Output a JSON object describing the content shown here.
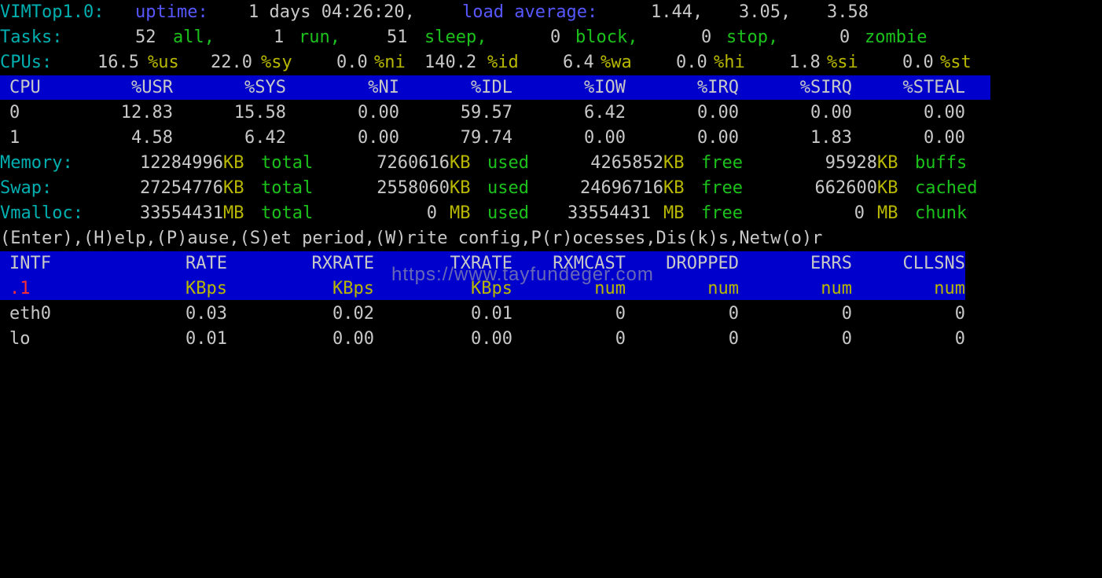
{
  "colors": {
    "background": "#000000",
    "header_bar": "#0000cc",
    "label_blue": "#5757ff",
    "label_cyan": "#00b0b0",
    "label_green": "#1cc21c",
    "unit_yellow": "#b8b800",
    "value_white": "#c8c8c8",
    "accent_red": "#ff3030"
  },
  "header": {
    "app": "VIMTop1.0:",
    "uptime_label": "uptime:",
    "uptime_value": "1 days 04:26:20,",
    "load_label": "load average:",
    "load_1": "1.44,",
    "load_5": "3.05,",
    "load_15": "3.58"
  },
  "tasks": {
    "label": "Tasks:",
    "all_value": "52",
    "all_label": "all,",
    "run_value": "1",
    "run_label": "run,",
    "sleep_value": "51",
    "sleep_label": "sleep,",
    "block_value": "0",
    "block_label": "block,",
    "stop_value": "0",
    "stop_label": "stop,",
    "zombie_value": "0",
    "zombie_label": "zombie"
  },
  "cpus": {
    "label": "CPUs:",
    "us_value": "16.5",
    "us_label": "%us",
    "sy_value": "22.0",
    "sy_label": "%sy",
    "ni_value": "0.0",
    "ni_label": "%ni",
    "id_value": "140.2",
    "id_label": "%id",
    "wa_value": "6.4",
    "wa_label": "%wa",
    "hi_value": "0.0",
    "hi_label": "%hi",
    "si_value": "1.8",
    "si_label": "%si",
    "st_value": "0.0",
    "st_label": "%st"
  },
  "cpu_table": {
    "headers": [
      "CPU",
      "%USR",
      "%SYS",
      "%NI",
      "%IDL",
      "%IOW",
      "%IRQ",
      "%SIRQ",
      "%STEAL"
    ],
    "rows": [
      [
        "0",
        "12.83",
        "15.58",
        "0.00",
        "59.57",
        "6.42",
        "0.00",
        "0.00",
        "0.00"
      ],
      [
        "1",
        "4.58",
        "6.42",
        "0.00",
        "79.74",
        "0.00",
        "0.00",
        "1.83",
        "0.00"
      ]
    ]
  },
  "memory": {
    "label": "Memory:",
    "total_value": "12284996",
    "total_unit": "KB",
    "total_label": "total",
    "used_value": "7260616",
    "used_unit": "KB",
    "used_label": "used",
    "free_value": "4265852",
    "free_unit": "KB",
    "free_label": "free",
    "buffs_value": "95928",
    "buffs_unit": "KB",
    "buffs_label": "buffs"
  },
  "swap": {
    "label": "Swap:",
    "total_value": "27254776",
    "total_unit": "KB",
    "total_label": "total",
    "used_value": "2558060",
    "used_unit": "KB",
    "used_label": "used",
    "free_value": "24696716",
    "free_unit": "KB",
    "free_label": "free",
    "cached_value": "662600",
    "cached_unit": "KB",
    "cached_label": "cached"
  },
  "vmalloc": {
    "label": "Vmalloc:",
    "total_value": "33554431",
    "total_unit": "MB",
    "total_label": "total",
    "used_value": "0",
    "used_unit": "MB",
    "used_label": "used",
    "free_value": "33554431",
    "free_unit": "MB",
    "free_label": "free",
    "chunk_value": "0",
    "chunk_unit": "MB",
    "chunk_label": "chunk"
  },
  "help_line": "(Enter),(H)elp,(P)ause,(S)et period,(W)rite config,P(r)ocesses,Dis(k)s,Netw(o)r",
  "net_table": {
    "headers": [
      "INTF",
      "RATE",
      "RXRATE",
      "TXRATE",
      "RXMCAST",
      "DROPPED",
      "ERRS",
      "CLLSNS"
    ],
    "units": [
      ".1",
      "KBps",
      "KBps",
      "KBps",
      "num",
      "num",
      "num",
      "num"
    ],
    "rows": [
      [
        "eth0",
        "0.03",
        "0.02",
        "0.01",
        "0",
        "0",
        "0",
        "0"
      ],
      [
        "lo",
        "0.01",
        "0.00",
        "0.00",
        "0",
        "0",
        "0",
        "0"
      ]
    ]
  },
  "watermark": "https://www.tayfundeger.com"
}
